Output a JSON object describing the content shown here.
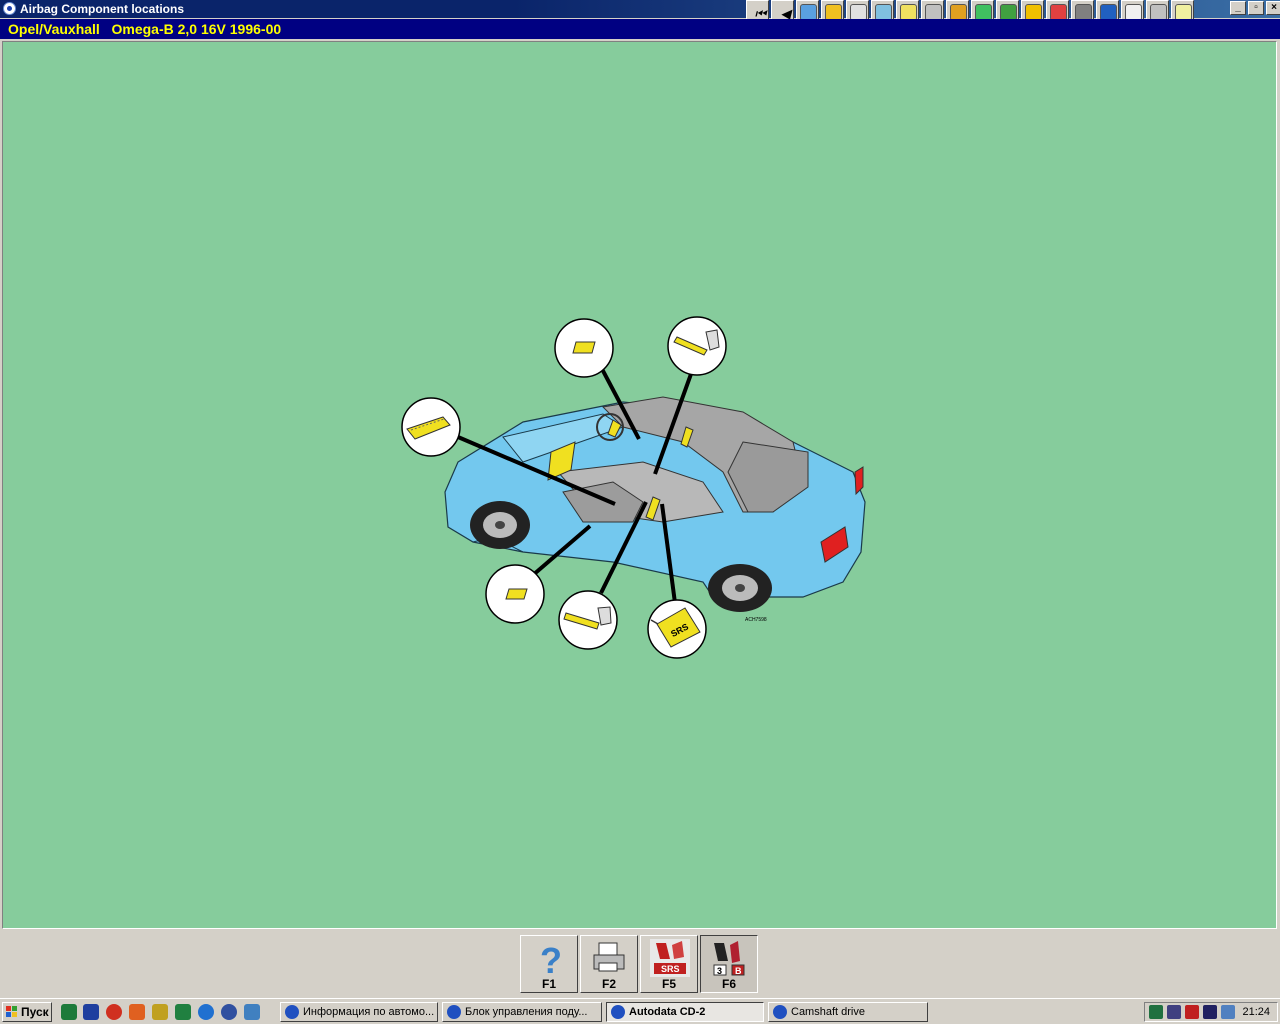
{
  "window": {
    "title": "Airbag Component locations",
    "vehicle_header": "Opel/Vauxhall   Omega-B 2,0 16V 1996-00"
  },
  "toolbar": {
    "icons": [
      "first-page-icon",
      "previous-page-icon",
      "wiring-icon",
      "engine-icon",
      "service-icon",
      "tools-icon",
      "tech-data-icon",
      "repair-times-icon",
      "timing-belt-icon",
      "key-programming-icon",
      "electrical-icon",
      "tyre-pressure-icon",
      "diagnostics-icon",
      "ecu-icon",
      "abs-icon",
      "warning-icon",
      "vehicle-icon",
      "notes-icon"
    ],
    "colors": [
      "#d4d0c8",
      "#d4d0c8",
      "#5aa0e0",
      "#f0c020",
      "#e0e0e0",
      "#80c0e0",
      "#f0e060",
      "#c0c0c0",
      "#e0a020",
      "#40c060",
      "#40a040",
      "#f0c000",
      "#e04040",
      "#808080",
      "#2060c0",
      "#f0f0f0",
      "#c0c0c0",
      "#f0f0a0"
    ]
  },
  "window_controls": {
    "minimize": "_",
    "restore": "▫",
    "close": "×"
  },
  "diagram": {
    "code_label": "ACH7598",
    "callouts": [
      "sensor-top",
      "seatbelt-pretensioner-right",
      "side-airbag-module",
      "sensor-bottom",
      "seatbelt-pretensioner-left",
      "srs-control-unit"
    ],
    "srs_text": "SRS",
    "body_color": "#73c8ee",
    "component_color": "#f0e020"
  },
  "function_keys": [
    {
      "label": "F1",
      "icon": "help-icon"
    },
    {
      "label": "F2",
      "icon": "print-icon"
    },
    {
      "label": "F5",
      "icon": "srs-icon",
      "badge": "SRS"
    },
    {
      "label": "F6",
      "icon": "seat-icon",
      "badge_left": "3",
      "badge_right": "B"
    }
  ],
  "taskbar": {
    "start_label": "Пуск",
    "tasks": [
      {
        "label": "Информация по автомо...",
        "active": false
      },
      {
        "label": "Блок управления поду...",
        "active": false
      },
      {
        "label": "Autodata CD-2",
        "active": true
      },
      {
        "label": "Camshaft drive",
        "active": false
      }
    ],
    "clock": "21:24"
  }
}
